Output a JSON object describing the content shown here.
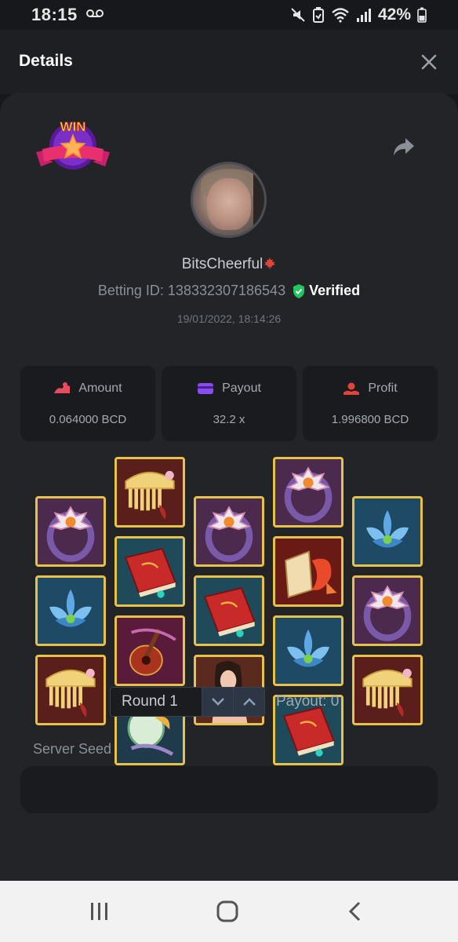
{
  "status_bar": {
    "time": "18:15",
    "battery_pct": "42%"
  },
  "header": {
    "title": "Details"
  },
  "bet": {
    "badge_text": "WIN",
    "username": "BitsCheerful",
    "betting_id": "Betting ID: 138332307186543",
    "verified_label": "Verified",
    "timestamp": "19/01/2022, 18:14:26"
  },
  "stats": [
    {
      "label": "Amount",
      "value": "0.064000 BCD",
      "icon": "amount-icon",
      "color": "#e84a5f"
    },
    {
      "label": "Payout",
      "value": "32.2 x",
      "icon": "payout-card-icon",
      "color": "#8a4cf0"
    },
    {
      "label": "Profit",
      "value": "1.996800 BCD",
      "icon": "profit-icon",
      "color": "#e0443a"
    }
  ],
  "reels": [
    [
      "ring",
      "flower",
      "comb"
    ],
    [
      "comb",
      "book",
      "lute",
      "fan"
    ],
    [
      "ring",
      "book",
      "lady"
    ],
    [
      "ring",
      "fish-scroll",
      "flower",
      "book"
    ],
    [
      "flower",
      "ring",
      "comb"
    ]
  ],
  "round": {
    "label": "Round 1",
    "payout": "Payout: 0"
  },
  "seed": {
    "label": "Server Seed"
  },
  "colors": {
    "accent_green": "#22c55e",
    "tile_border": "#e6c24a",
    "card_bg": "#232428"
  }
}
